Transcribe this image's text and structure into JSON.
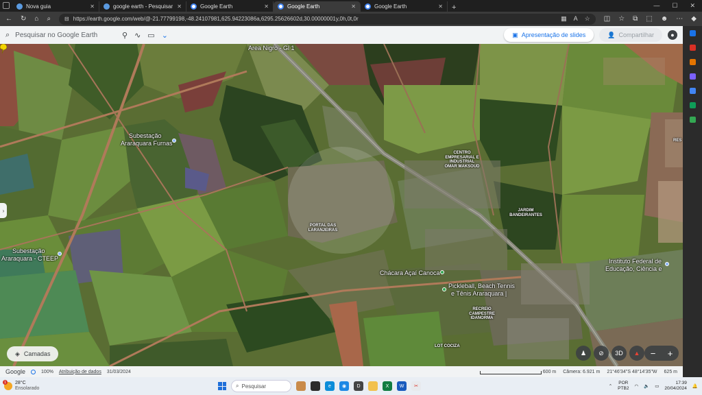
{
  "browser": {
    "tabs": [
      {
        "label": "Nova guia",
        "active": false
      },
      {
        "label": "google earth - Pesquisar",
        "active": false
      },
      {
        "label": "Google Earth",
        "active": false
      },
      {
        "label": "Google Earth",
        "active": true
      },
      {
        "label": "Google Earth",
        "active": false
      }
    ],
    "url": "https://earth.google.com/web/@-21.77799198,-48.24107981,625.94223086a,6295.25626602d,30.00000001y,0h,0t,0r"
  },
  "earth": {
    "search_placeholder": "Pesquisar no Google Earth",
    "slides_label": "Apresentação de slides",
    "share_label": "Compartilhar",
    "layers_label": "Camadas",
    "labels": {
      "area_nigro": "Area Nigro - Gl 1",
      "subestacao_furnas_1": "Subestação",
      "subestacao_furnas_2": "Araraquara Furnas",
      "subestacao_cteep_1": "Subestação",
      "subestacao_cteep_2": "Araraquara - CTEEP",
      "centro_empresarial": "CENTRO EMPRESARIAL E INDUSTRIAL OMAR MAKSOUD",
      "portal_laranjeiras": "PORTAL DAS LARANJEIRAS",
      "jardim_bandeirantes": "JARDIM BANDEIRANTES",
      "instituto_federal_1": "Instituto Federal de",
      "instituto_federal_2": "Educação, Ciência e",
      "chacara": "Chácara Açaí Canoca",
      "pickleball_1": "Pickleball, Beach Tennis",
      "pickleball_2": "e Tênis Araraquara |",
      "recreio": "RECREIO CAMPESTRE IDANORMA",
      "lot_cociza": "LOT COCIZA",
      "res": "RES"
    },
    "controls": {
      "three_d": "3D",
      "zoom_out": "−",
      "zoom_in": "+"
    },
    "status": {
      "google": "Google",
      "loaded": "100%",
      "attribution": "Atribuição de dados",
      "date": "31/03/2024",
      "scale": "600 m",
      "camera": "Câmera: 6.921 m",
      "coords": "21°46'34\"S 48°14'35\"W",
      "elevation": "625 m"
    }
  },
  "taskbar": {
    "temp": "28°C",
    "weather": "Ensolarado",
    "notif_count": "1",
    "search_label": "Pesquisar",
    "lang_1": "POR",
    "lang_2": "PTB2",
    "time": "17:39",
    "date": "20/04/2024"
  },
  "colors": {
    "accent": "#1a73e8",
    "road": "#8a8a7e",
    "dirt_road": "#b07a5a",
    "field_dark": "#2f4a22",
    "field_light": "#6f8a3a"
  }
}
